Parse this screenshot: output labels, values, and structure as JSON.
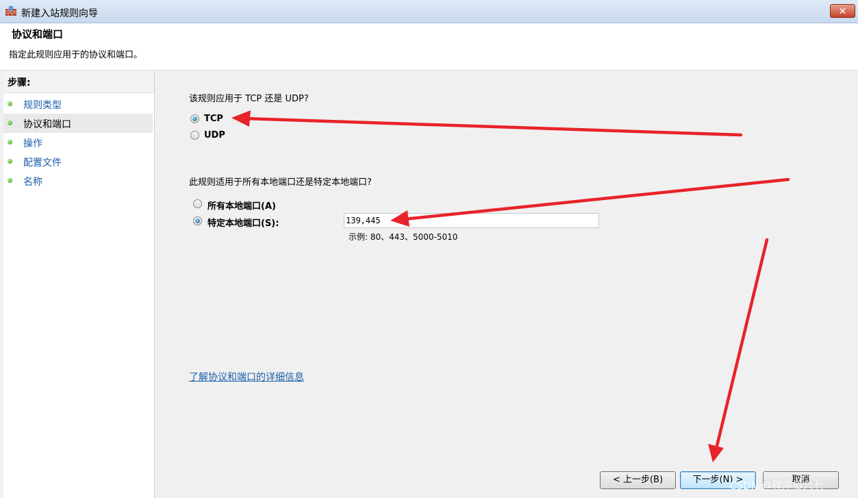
{
  "window": {
    "title": "新建入站规则向导",
    "close_label": "✕"
  },
  "header": {
    "title": "协议和端口",
    "description": "指定此规则应用于的协议和端口。"
  },
  "sidebar": {
    "heading": "步骤:",
    "items": [
      {
        "label": "规则类型"
      },
      {
        "label": "协议和端口"
      },
      {
        "label": "操作"
      },
      {
        "label": "配置文件"
      },
      {
        "label": "名称"
      }
    ]
  },
  "main": {
    "protocol_question": "该规则应用于 TCP 还是 UDP?",
    "protocol_options": [
      {
        "label": "TCP",
        "checked": true
      },
      {
        "label": "UDP",
        "checked": false
      }
    ],
    "port_question": "此规则适用于所有本地端口还是特定本地端口?",
    "port_options": [
      {
        "label": "所有本地端口(A)",
        "checked": false
      },
      {
        "label": "特定本地端口(S):",
        "checked": true
      }
    ],
    "port_value": "139,445",
    "port_example": "示例: 80、443、5000-5010",
    "info_link": "了解协议和端口的详细信息"
  },
  "buttons": {
    "back": "< 上一步(B)",
    "next": "下一步(N) >",
    "cancel": "取消"
  },
  "watermark": "CSDN @程序员六七",
  "colors": {
    "accent_link": "#1a5fa8",
    "arrow": "#e8232a",
    "step_dot": "#3e9a1e"
  }
}
